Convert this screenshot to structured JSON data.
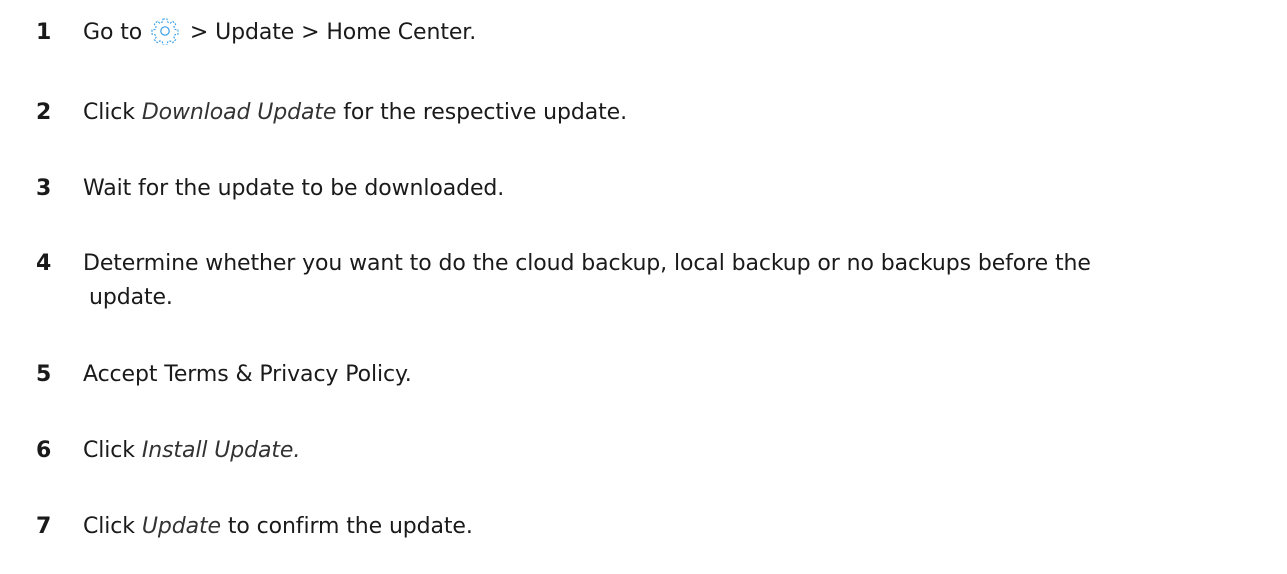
{
  "steps": [
    {
      "number": "1",
      "prefix": "Go to",
      "suffix": "> Update > Home Center.",
      "icon": "settings-gear-icon"
    },
    {
      "number": "2",
      "before": "Click",
      "emphasis": "Download Update",
      "after": "for the respective update."
    },
    {
      "number": "3",
      "text": "Wait for the update to be downloaded."
    },
    {
      "number": "4",
      "line1": "Determine whether you want to do the cloud backup, local backup or no backups before the",
      "line2": "update."
    },
    {
      "number": "5",
      "text": "Accept Terms & Privacy Policy."
    },
    {
      "number": "6",
      "before": "Click",
      "emphasis": "Install Update."
    },
    {
      "number": "7",
      "before": "Click",
      "emphasis": "Update",
      "after": "to confirm the update."
    }
  ],
  "colors": {
    "text": "#1a1a1a",
    "icon_accent": "#3aa0e8"
  }
}
